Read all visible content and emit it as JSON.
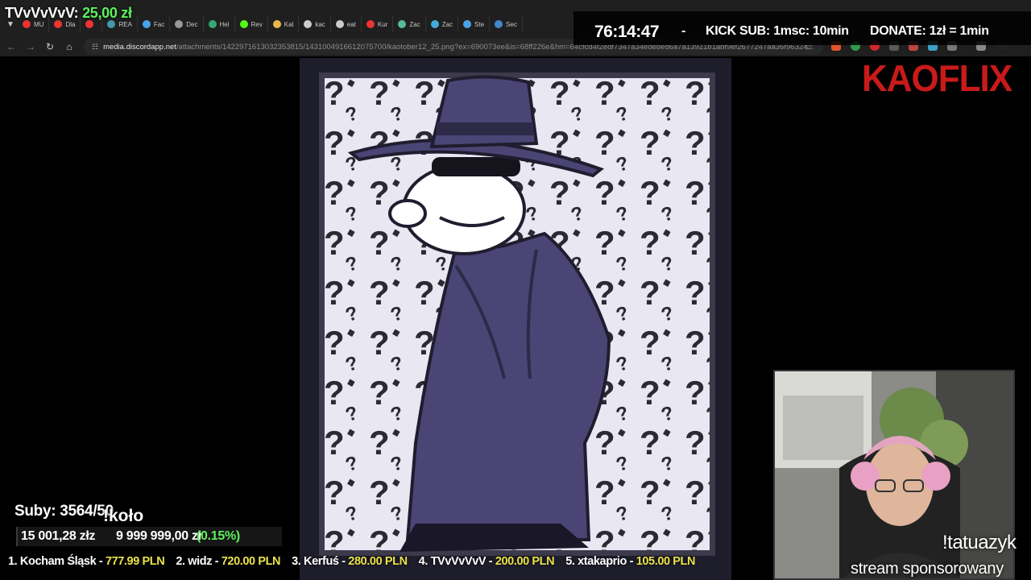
{
  "overlay_title": {
    "name": "TVvVvVvV:",
    "amount": "25,00 zł"
  },
  "tabs": [
    {
      "label": "MU",
      "color": "#e33"
    },
    {
      "label": "Dla",
      "color": "#e33"
    },
    {
      "label": "",
      "color": "#e33"
    },
    {
      "label": "REA",
      "color": "#49a"
    },
    {
      "label": "Fac",
      "color": "#4aa3e8"
    },
    {
      "label": "Dec",
      "color": "#999"
    },
    {
      "label": "Hel",
      "color": "#3a7"
    },
    {
      "label": "Rev",
      "color": "#53fc18"
    },
    {
      "label": "Kal",
      "color": "#e8b84a"
    },
    {
      "label": "kac",
      "color": "#ccc"
    },
    {
      "label": "eat",
      "color": "#ccc"
    },
    {
      "label": "Kur",
      "color": "#e33"
    },
    {
      "label": "Zac",
      "color": "#5b9"
    },
    {
      "label": "Zac",
      "color": "#4ad"
    },
    {
      "label": "Ste",
      "color": "#4aa3e8"
    },
    {
      "label": "Sec",
      "color": "#48c"
    }
  ],
  "browser": {
    "url_host": "media.discordapp.net",
    "url_path": "/attachments/1422971613032353815/1431004916612075700/kaotober12_25.png?ex=690073ee&is=68ff226e&hm=64cfcd4f2edf7347a34edebed6a7a13921b1abf9ef2677247aa36f96324..."
  },
  "stream_info": {
    "timer": "76:14:47",
    "separator": "-",
    "kick_sub": "KICK SUB: 1msc: 10min",
    "donate": "DONATE: 1zł = 1min"
  },
  "brand": {
    "logo_text": "KAOFLIX",
    "color": "#c91a1a"
  },
  "subs": {
    "label": "Suby: 3564/50"
  },
  "koto": {
    "label": "!koło"
  },
  "goal": {
    "current": "15 001,28 złz",
    "target": "9 999 999,00 zł",
    "percent_label": "(0.15%)",
    "fraction": 0.0015
  },
  "leaderboard": [
    {
      "name": "1. Kocham Śląsk - ",
      "amount": "777.99 PLN"
    },
    {
      "name": "2. widz - ",
      "amount": "720.00 PLN"
    },
    {
      "name": "3. Kerfuś - ",
      "amount": "280.00 PLN"
    },
    {
      "name": "4. TVvVvVvV - ",
      "amount": "200.00 PLN"
    },
    {
      "name": "5. xtakaprio - ",
      "amount": "105.00 PLN"
    }
  ],
  "webcam": {
    "command": "!tatuazyk",
    "sponsor": "stream sponsorowany"
  },
  "colors": {
    "accent_green": "#5cf25c",
    "leaderboard_amount": "#e9e24b",
    "art_purple": "#443f6b"
  },
  "icons": [
    "chevron-down-icon",
    "back-icon",
    "forward-icon",
    "reload-icon",
    "home-icon",
    "site-info-icon",
    "star-icon",
    "extensions-icon",
    "menu-icon"
  ]
}
